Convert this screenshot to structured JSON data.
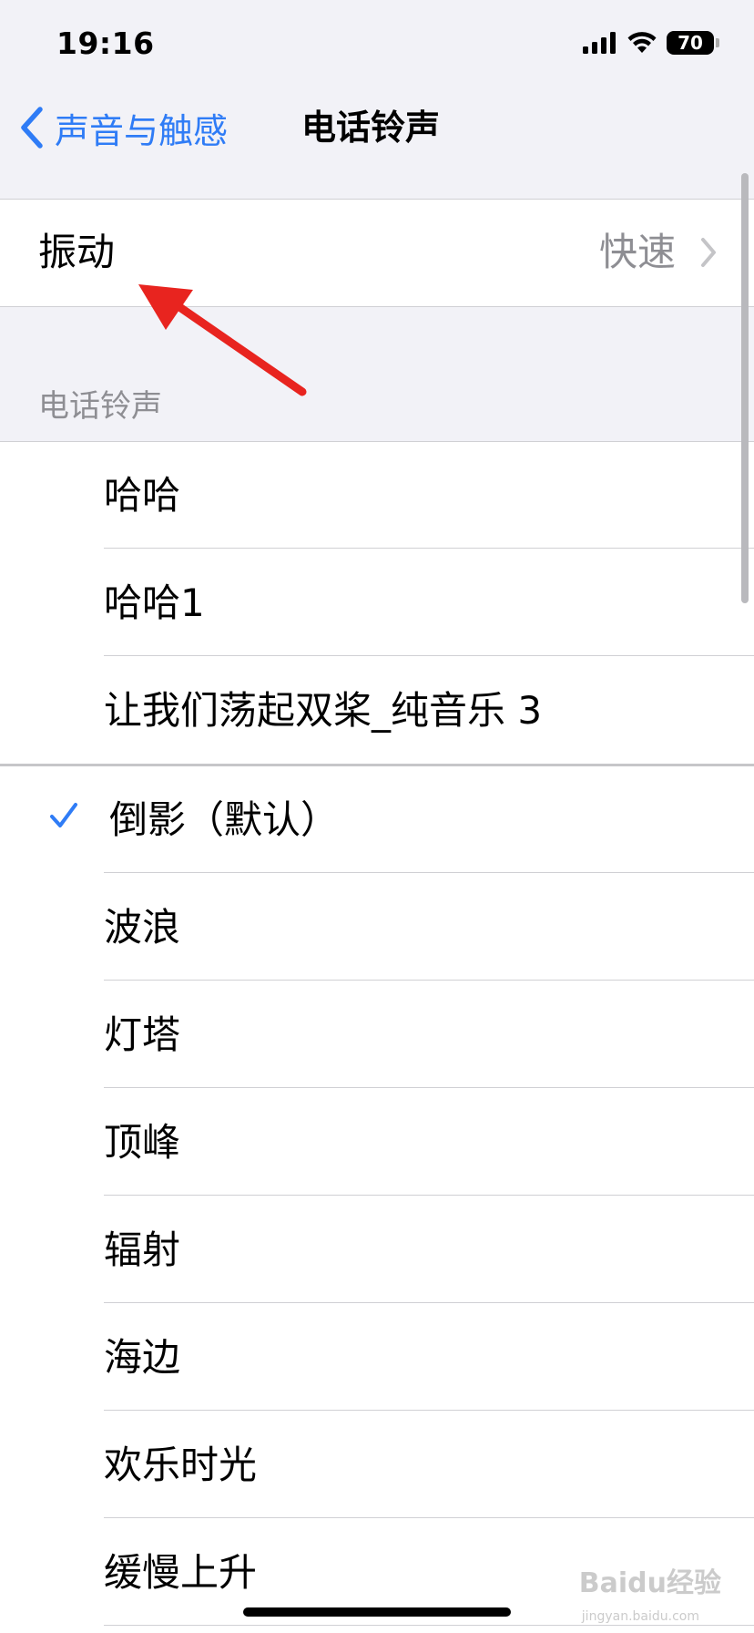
{
  "status_bar": {
    "time": "19:16",
    "battery": "70"
  },
  "nav": {
    "back_label": "声音与触感",
    "title": "电话铃声"
  },
  "vibration": {
    "label": "振动",
    "value": "快速"
  },
  "section_header": "电话铃声",
  "custom_tones": [
    {
      "label": "哈哈"
    },
    {
      "label": "哈哈1"
    },
    {
      "label": "让我们荡起双桨_纯音乐 3"
    }
  ],
  "system_tones": [
    {
      "label": "倒影（默认）",
      "selected": true
    },
    {
      "label": "波浪"
    },
    {
      "label": "灯塔"
    },
    {
      "label": "顶峰"
    },
    {
      "label": "辐射"
    },
    {
      "label": "海边"
    },
    {
      "label": "欢乐时光"
    },
    {
      "label": "缓慢上升"
    }
  ],
  "watermark": {
    "text": "Baidu经验",
    "sub": "jingyan.baidu.com"
  },
  "colors": {
    "accent": "#2f7cf6",
    "annotation_arrow": "#e8241f",
    "background": "#f2f2f7"
  }
}
